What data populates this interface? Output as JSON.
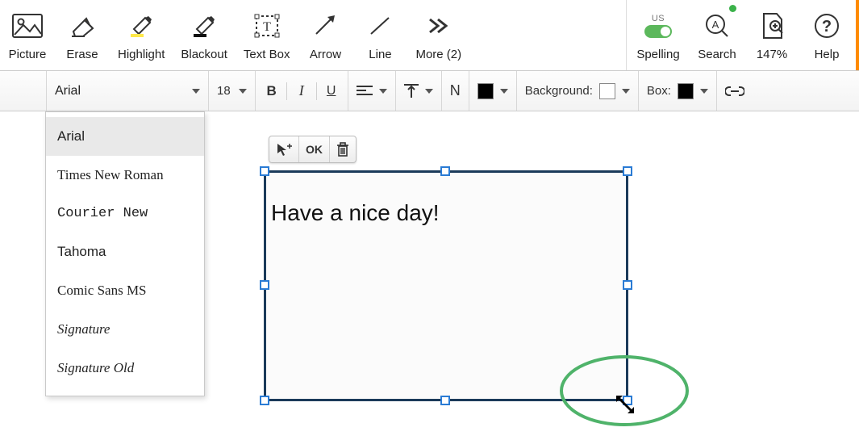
{
  "toolbar": {
    "picture": "Picture",
    "erase": "Erase",
    "highlight": "Highlight",
    "blackout": "Blackout",
    "textbox": "Text Box",
    "arrow": "Arrow",
    "line": "Line",
    "more": "More (2)",
    "spelling": "Spelling",
    "spelling_lang": "US",
    "search": "Search",
    "zoom": "147%",
    "help": "Help"
  },
  "format": {
    "font": "Arial",
    "size": "18",
    "bold": "B",
    "italic": "I",
    "underline": "U",
    "normal": "N",
    "background_label": "Background:",
    "box_label": "Box:"
  },
  "font_options": {
    "arial": "Arial",
    "times": "Times New Roman",
    "courier": "Courier New",
    "tahoma": "Tahoma",
    "comic": "Comic Sans MS",
    "sig": "Signature",
    "sig_old": "Signature Old"
  },
  "textbox_toolbar": {
    "ok": "OK"
  },
  "textbox_content": "Have a nice day!"
}
